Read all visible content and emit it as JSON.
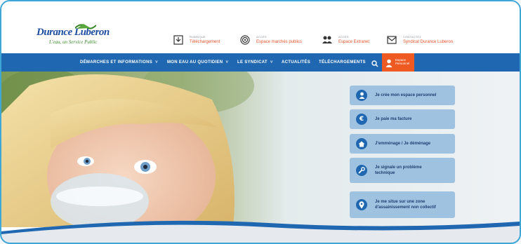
{
  "brand": {
    "logo_main": "Durance Luberon",
    "logo_sub": "L'eau, un Service Public"
  },
  "top_tiles": [
    {
      "small": "Rubrique",
      "big": "Téléchargement",
      "icon": "download-icon"
    },
    {
      "small": "Accès",
      "big": "Espace marchés publics",
      "icon": "target-icon"
    },
    {
      "small": "Accès",
      "big": "Espace Extranet",
      "icon": "people-icon"
    },
    {
      "small": "Contactez",
      "big": "Syndicat Durance Luberon",
      "icon": "mail-icon"
    }
  ],
  "nav": {
    "items": [
      {
        "label": "DÉMARCHES ET INFORMATIONS",
        "caret": "˅"
      },
      {
        "label": "MON EAU AU QUOTIDIEN",
        "caret": "˅"
      },
      {
        "label": "LE SYNDICAT",
        "caret": "˅"
      },
      {
        "label": "ACTUALITÉS",
        "caret": ""
      },
      {
        "label": "TÉLÉCHARGEMENTS",
        "caret": ""
      }
    ],
    "personal_line1": "Espace",
    "personal_line2": "Personnel"
  },
  "actions": [
    {
      "label": "Je crée mon espace personnel",
      "icon": "user-icon"
    },
    {
      "label": "Je paie ma facture",
      "icon": "euro-icon"
    },
    {
      "label": "J'emménage / Je déménage",
      "icon": "home-icon"
    },
    {
      "label_line1": "Je signale un problème",
      "label_line2": "technique",
      "icon": "wrench-icon"
    },
    {
      "label_line1": "Je me situe sur une zone",
      "label_line2": "d'assainissement non collectif",
      "icon": "location-icon"
    }
  ],
  "colors": {
    "nav": "#1f67b0",
    "accent": "#ef5a22",
    "action_bg": "#9fc2e0",
    "frame": "#3fa7d6"
  }
}
